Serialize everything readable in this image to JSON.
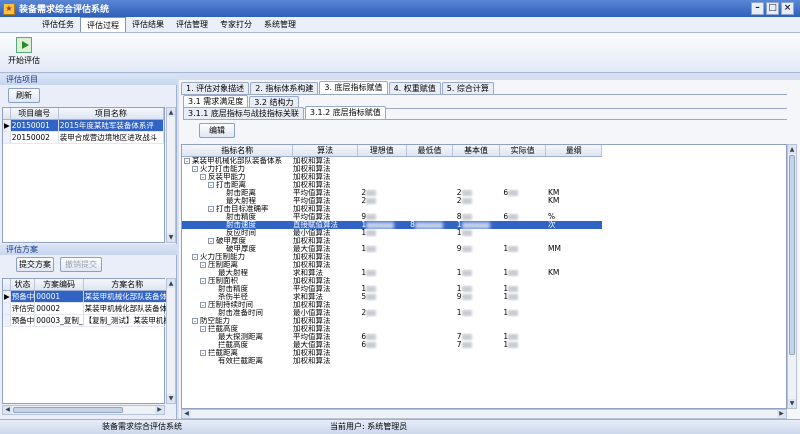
{
  "window": {
    "title": "装备需求综合评估系统"
  },
  "menu": [
    "评估任务",
    "评估过程",
    "评估结果",
    "评估管理",
    "专家打分",
    "系统管理"
  ],
  "toolbar": {
    "start_eval_label": "开始评估"
  },
  "projects": {
    "section_label": "评估项目",
    "refresh_label": "刷新",
    "columns": [
      "项目编号",
      "项目名称"
    ],
    "rows": [
      {
        "id": "20150001",
        "name": "2015年度某陆军装备体系评",
        "selected": true
      },
      {
        "id": "20150002",
        "name": "装甲合成营边境地区进攻战斗",
        "selected": false
      }
    ]
  },
  "schemes": {
    "section_label": "评估方案",
    "submit_label": "提交方案",
    "withdraw_label": "撤销提交",
    "columns": [
      "状态",
      "方案编码",
      "方案名称"
    ],
    "rows": [
      {
        "status": "预备中",
        "code": "00001",
        "name": "某装甲机械化部队装备体",
        "selected": true
      },
      {
        "status": "评估完",
        "code": "00002",
        "name": "某装甲机械化部队装备体",
        "selected": false
      },
      {
        "status": "预备中",
        "code": "00003_复制_",
        "name": "【复制_测试】某装甲机械",
        "selected": false
      }
    ]
  },
  "tabs_level1": [
    "1. 评估对象描述",
    "2. 指标体系构建",
    "3. 底层指标赋值",
    "4. 权重赋值",
    "5. 综合计算"
  ],
  "tabs_level2": [
    "3.1 需求满足度",
    "3.2 结构力"
  ],
  "tabs_level3": [
    "3.1.1 底层指标与战技指标关联",
    "3.1.2 底层指标赋值"
  ],
  "edit_label": "编辑",
  "tree": {
    "columns": [
      "指标名称",
      "算法",
      "理想值",
      "最低值",
      "基本值",
      "实际值",
      "量纲"
    ],
    "rows": [
      {
        "depth": 0,
        "toggle": "-",
        "name": "某装甲机械化部队装备体系",
        "algo": "加权和算法",
        "ideal": "",
        "min": "",
        "basic": "",
        "actual": "",
        "unit": ""
      },
      {
        "depth": 1,
        "toggle": "-",
        "name": "火力打击能力",
        "algo": "加权和算法",
        "ideal": "",
        "min": "",
        "basic": "",
        "actual": "",
        "unit": ""
      },
      {
        "depth": 2,
        "toggle": "-",
        "name": "反装甲能力",
        "algo": "加权和算法",
        "ideal": "",
        "min": "",
        "basic": "",
        "actual": "",
        "unit": ""
      },
      {
        "depth": 3,
        "toggle": "-",
        "name": "打击距离",
        "algo": "加权和算法",
        "ideal": "",
        "min": "",
        "basic": "",
        "actual": "",
        "unit": ""
      },
      {
        "depth": 4,
        "toggle": "",
        "name": "射击距离",
        "algo": "平均值算法",
        "ideal": "2",
        "min": "",
        "basic": "2",
        "actual": "6",
        "unit": "KM"
      },
      {
        "depth": 4,
        "toggle": "",
        "name": "最大射程",
        "algo": "平均值算法",
        "ideal": "2",
        "min": "",
        "basic": "2",
        "actual": "",
        "unit": "KM"
      },
      {
        "depth": 3,
        "toggle": "-",
        "name": "打击目标准确率",
        "algo": "加权和算法",
        "ideal": "",
        "min": "",
        "basic": "",
        "actual": "",
        "unit": ""
      },
      {
        "depth": 4,
        "toggle": "",
        "name": "射击精度",
        "algo": "平均值算法",
        "ideal": "9",
        "min": "",
        "basic": "8",
        "actual": "6",
        "unit": "%"
      },
      {
        "depth": 4,
        "toggle": "",
        "name": "射击速度",
        "algo": "直接赋值算法",
        "ideal": "1",
        "min": "8",
        "basic": "1",
        "actual": "",
        "unit": "次",
        "selected": true
      },
      {
        "depth": 4,
        "toggle": "",
        "name": "反应时间",
        "algo": "最小值算法",
        "ideal": "1",
        "min": "",
        "basic": "1",
        "actual": "",
        "unit": ""
      },
      {
        "depth": 3,
        "toggle": "-",
        "name": "破甲厚度",
        "algo": "加权和算法",
        "ideal": "",
        "min": "",
        "basic": "",
        "actual": "",
        "unit": ""
      },
      {
        "depth": 4,
        "toggle": "",
        "name": "破甲厚度",
        "algo": "最大值算法",
        "ideal": "1",
        "min": "",
        "basic": "9",
        "actual": "1",
        "unit": "MM"
      },
      {
        "depth": 1,
        "toggle": "-",
        "name": "火力压制能力",
        "algo": "加权和算法",
        "ideal": "",
        "min": "",
        "basic": "",
        "actual": "",
        "unit": ""
      },
      {
        "depth": 2,
        "toggle": "-",
        "name": "压制距离",
        "algo": "加权和算法",
        "ideal": "",
        "min": "",
        "basic": "",
        "actual": "",
        "unit": ""
      },
      {
        "depth": 3,
        "toggle": "",
        "name": "最大射程",
        "algo": "求和算法",
        "ideal": "1",
        "min": "",
        "basic": "1",
        "actual": "1",
        "unit": "KM"
      },
      {
        "depth": 2,
        "toggle": "-",
        "name": "压制面积",
        "algo": "加权和算法",
        "ideal": "",
        "min": "",
        "basic": "",
        "actual": "",
        "unit": ""
      },
      {
        "depth": 3,
        "toggle": "",
        "name": "射击精度",
        "algo": "平均值算法",
        "ideal": "1",
        "min": "",
        "basic": "1",
        "actual": "1",
        "unit": ""
      },
      {
        "depth": 3,
        "toggle": "",
        "name": "杀伤半径",
        "algo": "求和算法",
        "ideal": "5",
        "min": "",
        "basic": "9",
        "actual": "1",
        "unit": ""
      },
      {
        "depth": 2,
        "toggle": "-",
        "name": "压制持续时间",
        "algo": "加权和算法",
        "ideal": "",
        "min": "",
        "basic": "",
        "actual": "",
        "unit": ""
      },
      {
        "depth": 3,
        "toggle": "",
        "name": "射击准备时间",
        "algo": "最小值算法",
        "ideal": "2",
        "min": "",
        "basic": "1",
        "actual": "1",
        "unit": ""
      },
      {
        "depth": 1,
        "toggle": "-",
        "name": "防空能力",
        "algo": "加权和算法",
        "ideal": "",
        "min": "",
        "basic": "",
        "actual": "",
        "unit": ""
      },
      {
        "depth": 2,
        "toggle": "-",
        "name": "拦截高度",
        "algo": "加权和算法",
        "ideal": "",
        "min": "",
        "basic": "",
        "actual": "",
        "unit": ""
      },
      {
        "depth": 3,
        "toggle": "",
        "name": "最大探测距离",
        "algo": "平均值算法",
        "ideal": "6",
        "min": "",
        "basic": "7",
        "actual": "1",
        "unit": ""
      },
      {
        "depth": 3,
        "toggle": "",
        "name": "拦截高度",
        "algo": "最大值算法",
        "ideal": "6",
        "min": "",
        "basic": "7",
        "actual": "1",
        "unit": ""
      },
      {
        "depth": 2,
        "toggle": "-",
        "name": "拦截距离",
        "algo": "加权和算法",
        "ideal": "",
        "min": "",
        "basic": "",
        "actual": "",
        "unit": ""
      },
      {
        "depth": 3,
        "toggle": "",
        "name": "有效拦截距离",
        "algo": "加权和算法",
        "ideal": "",
        "min": "",
        "basic": "",
        "actual": "",
        "unit": ""
      }
    ]
  },
  "status": {
    "app_name": "装备需求综合评估系统",
    "current_user": "当前用户: 系统管理员"
  },
  "colors": {
    "accent": "#3163c5",
    "title_bar": "#3d6cc4"
  }
}
